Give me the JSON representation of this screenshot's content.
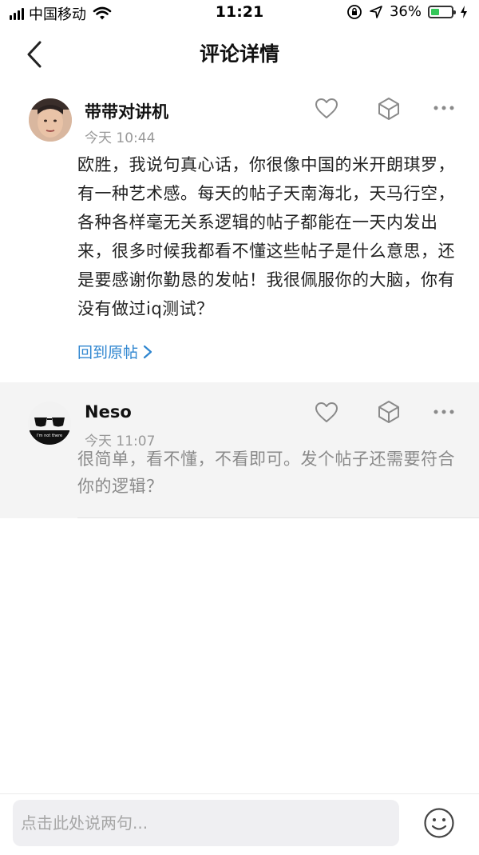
{
  "status_bar": {
    "carrier": "中国移动",
    "time": "11:21",
    "battery": "36%"
  },
  "header": {
    "title": "评论详情"
  },
  "main_comment": {
    "author": "带带对讲机",
    "time": "今天 10:44",
    "text": "欧胜，我说句真心话，你很像中国的米开朗琪罗，有一种艺术感。每天的帖子天南海北，天马行空，各种各样毫无关系逻辑的帖子都能在一天内发出来，很多时候我都看不懂这些帖子是什么意思，还是要感谢你勤恳的发帖！我很佩服你的大脑，你有没有做过iq测试？",
    "back_link": "回到原帖"
  },
  "reply": {
    "author": "Neso",
    "time": "今天 11:07",
    "text": "很简单，看不懂，不看即可。发个帖子还需要符合你的逻辑？",
    "avatar_caption": "i'm not there"
  },
  "composer": {
    "placeholder": "点击此处说两句..."
  },
  "colors": {
    "link": "#2f86d0",
    "battery": "#34c759",
    "reply_bg": "#f4f4f4"
  },
  "icons": [
    "wifi-icon",
    "lock-rotation-icon",
    "location-arrow-icon",
    "charging-icon",
    "back-chevron-icon",
    "heart-icon",
    "cube-icon",
    "more-icon",
    "smiley-icon"
  ]
}
